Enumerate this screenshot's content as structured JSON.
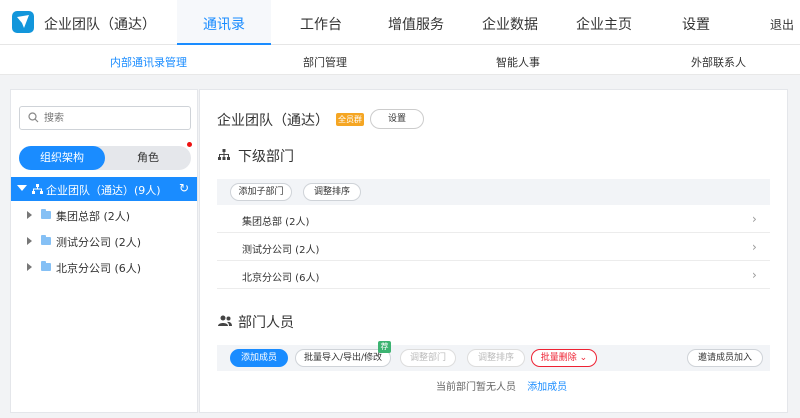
{
  "topbar": {
    "org_name": "企业团队（通达）",
    "nav": [
      "通讯录",
      "工作台",
      "增值服务",
      "企业数据",
      "企业主页",
      "设置"
    ],
    "logout": "退出"
  },
  "subnav": [
    "内部通讯录管理",
    "部门管理",
    "智能人事",
    "外部联系人"
  ],
  "sidebar": {
    "search_placeholder": "搜索",
    "tabs": [
      "组织架构",
      "角色"
    ],
    "root": "企业团队（通达）(9人)",
    "children": [
      "集团总部 (2人)",
      "测试分公司 (2人)",
      "北京分公司 (6人)"
    ]
  },
  "main": {
    "title": "企业团队（通达）",
    "badge": "全员群",
    "settings": "设置",
    "sub_title": "下级部门",
    "sub_buttons": [
      "添加子部门",
      "调整排序"
    ],
    "departments": [
      "集团总部  (2人)",
      "测试分公司  (2人)",
      "北京分公司  (6人)"
    ],
    "members_title": "部门人员",
    "member_buttons": {
      "add": "添加成员",
      "import": "批量导入/导出/修改",
      "rec": "荐",
      "adjust_dept": "调整部门",
      "adjust_order": "调整排序",
      "batch_delete": "批量删除",
      "invite": "邀请成员加入"
    },
    "empty_text": "当前部门暂无人员",
    "empty_link": "添加成员"
  },
  "colors": {
    "accent": "#1a8cff",
    "danger": "#e22233",
    "badge": "#f5a623"
  }
}
